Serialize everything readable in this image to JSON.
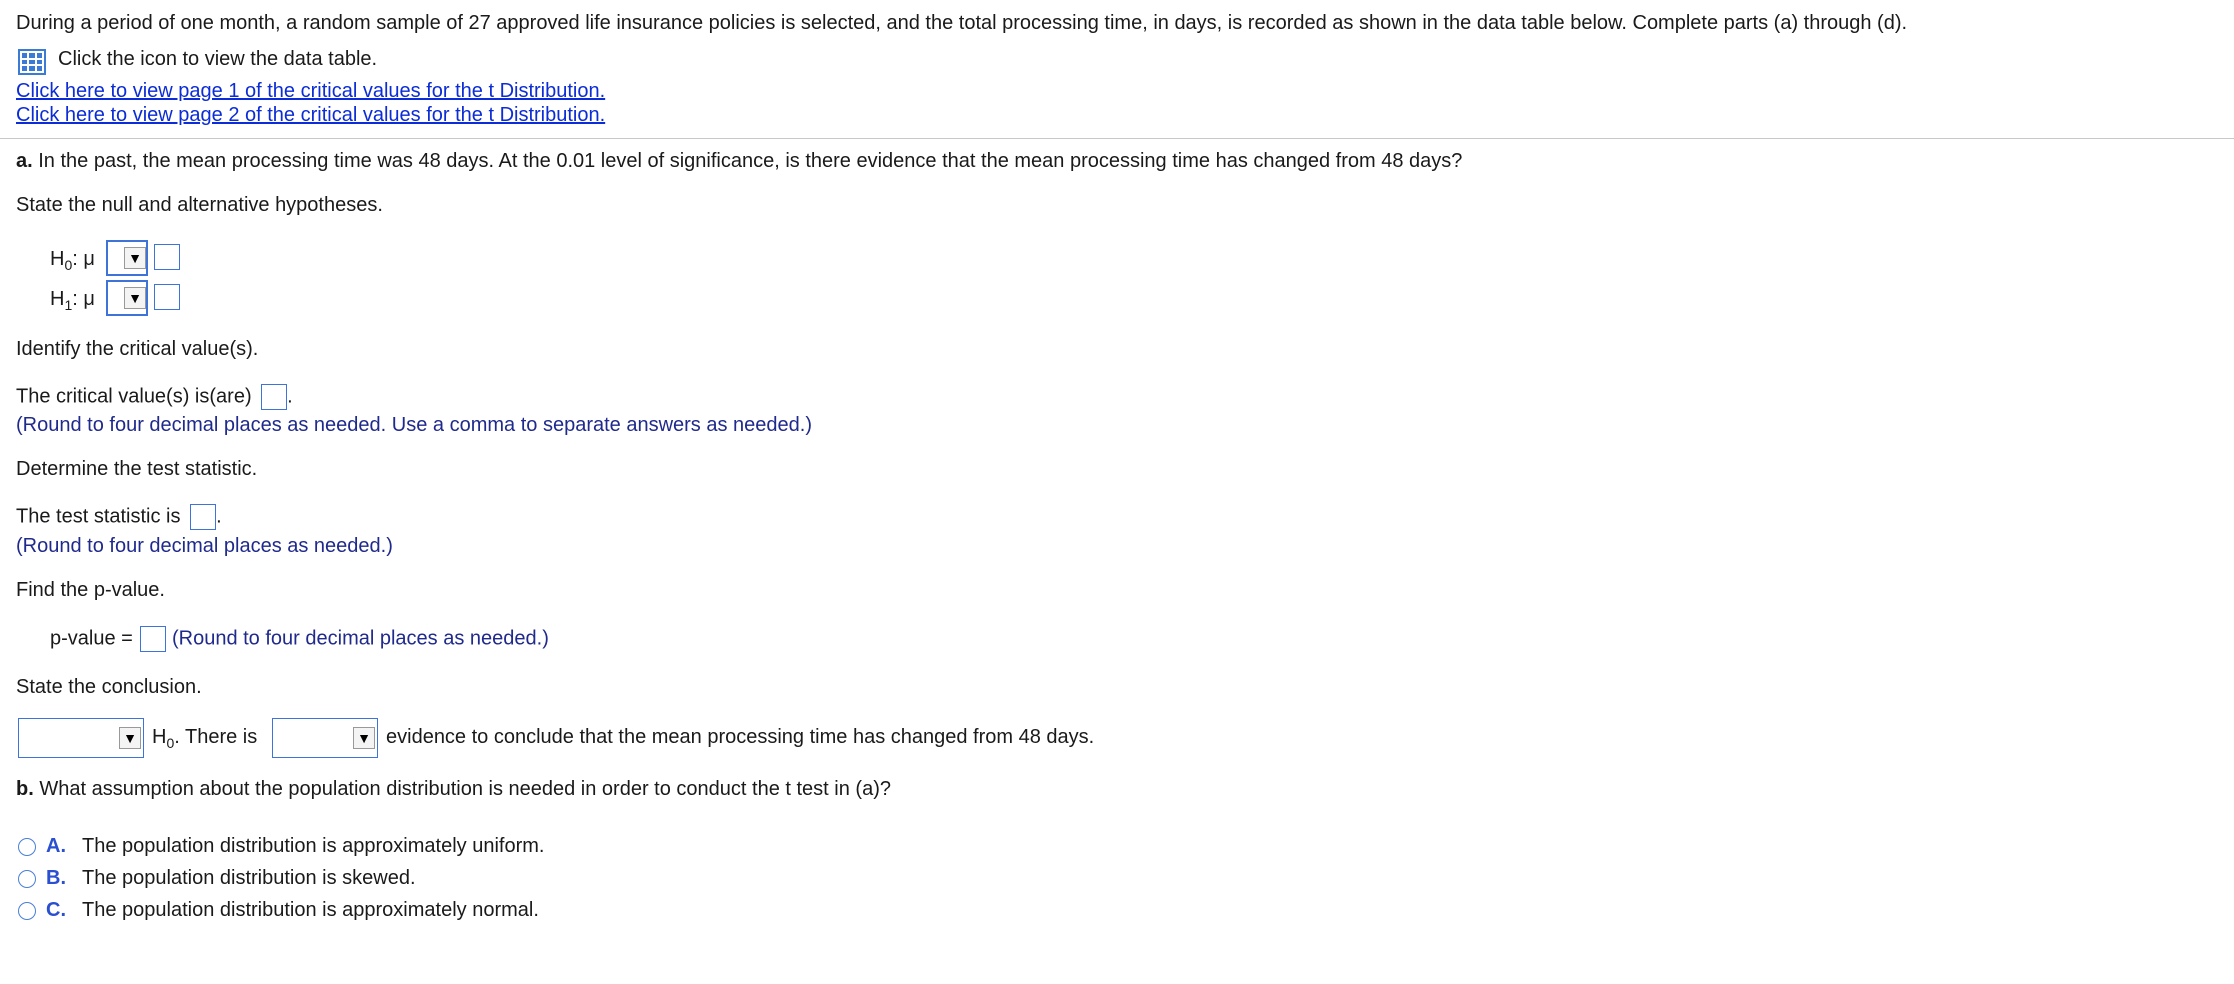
{
  "problem": {
    "intro": "During a period of one month, a random sample of 27 approved life insurance policies is selected, and the total processing time, in days, is recorded as shown in the data table below. Complete parts (a) through (d).",
    "icon_text": "Click the icon to view the data table.",
    "link1": "Click here to view page 1 of the critical values for the t Distribution.",
    "link2": "Click here to view page 2 of the critical values for the t Distribution."
  },
  "part_a": {
    "label": "a.",
    "question": "In the past, the mean processing time was 48 days. At the 0.01 level of significance, is there evidence that the mean processing time has changed from 48 days?",
    "state_hyp": "State the null and alternative hypotheses.",
    "h0_prefix": "H",
    "h0_sub": "0",
    "h1_prefix": "H",
    "h1_sub": "1",
    "hyp_suffix": ": μ",
    "identify_cv": "Identify the critical value(s).",
    "cv_label": "The critical value(s) is(are)",
    "cv_note": "(Round to four decimal places as needed. Use a comma to separate answers as needed.)",
    "determine_ts": "Determine the test statistic.",
    "ts_label": "The test statistic is",
    "ts_note": "(Round to four decimal places as needed.)",
    "find_p": "Find the p-value.",
    "p_label": "p-value =",
    "p_note": "(Round to four decimal places as needed.)",
    "state_concl": "State the conclusion.",
    "concl_h": "H",
    "concl_sub": "0",
    "concl_mid": ". There is",
    "concl_end": "evidence to conclude that the mean processing time has changed from 48 days."
  },
  "part_b": {
    "label": "b.",
    "question": "What assumption about the population distribution is needed in order to conduct the t test in (a)?",
    "options": [
      {
        "letter": "A.",
        "text": "The population distribution is approximately uniform."
      },
      {
        "letter": "B.",
        "text": "The population distribution is skewed."
      },
      {
        "letter": "C.",
        "text": "The population distribution is approximately normal."
      }
    ]
  },
  "icons": {
    "table": "data-table-icon",
    "dropdown": "triangle-down-icon"
  },
  "colors": {
    "link": "#0b2cd6",
    "note": "#1f2a8c",
    "input_border": "#3e74d8"
  }
}
